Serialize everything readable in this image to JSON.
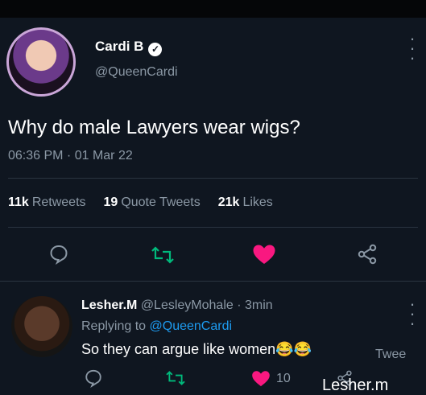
{
  "tweet": {
    "author_name": "Cardi B",
    "author_handle": "@QueenCardi",
    "text": "Why do male Lawyers wear wigs?",
    "timestamp": "06:36 PM · 01 Mar 22",
    "stats": {
      "retweets_count": "11k",
      "retweets_label": "Retweets",
      "quotes_count": "19",
      "quotes_label": "Quote Tweets",
      "likes_count": "21k",
      "likes_label": "Likes"
    }
  },
  "reply": {
    "author_name": "Lesher.M",
    "author_handle": "@LesleyMohale",
    "time": "· 3min",
    "replying_prefix": "Replying to",
    "replying_handle": "@QueenCardi",
    "text": "So they can argue like women😂😂",
    "tweet_button_label": "Twee",
    "like_count": "10"
  },
  "watermark": "Lesher.m",
  "colors": {
    "background": "#0f1620",
    "like_red": "#f91880",
    "retweet_green": "#00ba7c",
    "link_blue": "#1d9bf0",
    "muted": "#8b98a5"
  }
}
